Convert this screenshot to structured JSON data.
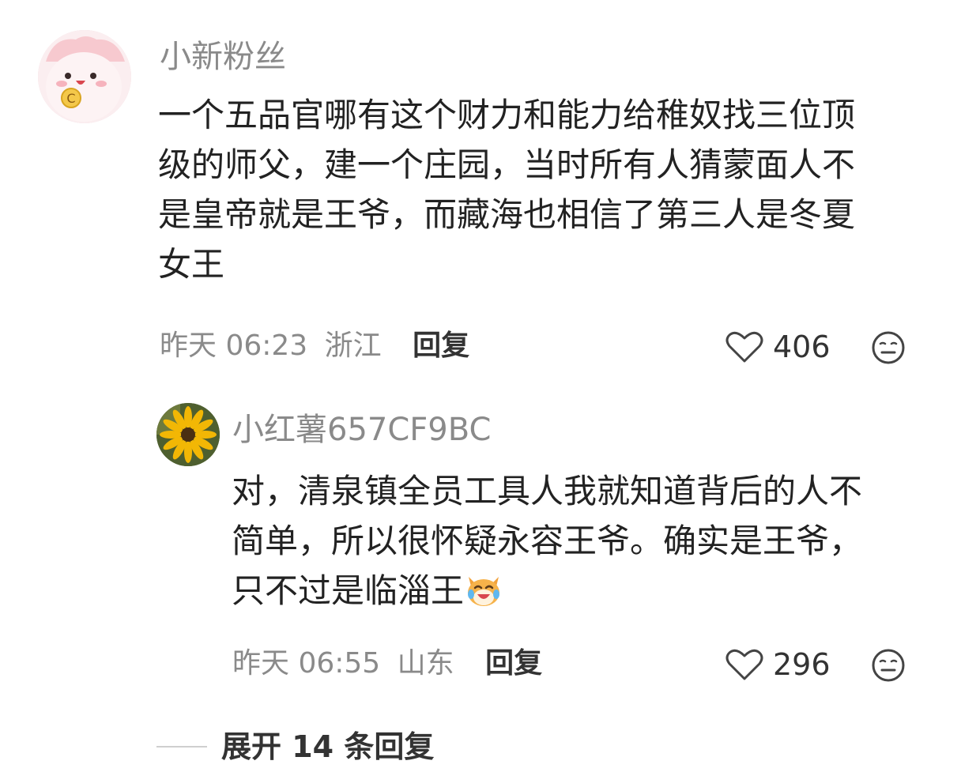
{
  "comment": {
    "username": "小新粉丝",
    "lines": [
      "一个五品官哪有这个财力和能力给稚奴找三位顶",
      "级的师父，建一个庄园，当时所有人猜蒙面人不",
      "是皇帝就是王爷，而藏海也相信了第三人是冬夏",
      "女王"
    ],
    "time": "昨天 06:23",
    "location": "浙江",
    "reply_label": "回复",
    "likes": "406",
    "avatar_icon": "cartoon-avatar-icon"
  },
  "reply": {
    "username": "小红薯657CF9BC",
    "lines": [
      "对，清泉镇全员工具人我就知道背后的人不",
      "简单，所以很怀疑永容王爷。确实是王爷，",
      "只不过是临淄王"
    ],
    "emoji": "laughing-cat-emoji",
    "time": "昨天 06:55",
    "location": "山东",
    "reply_label": "回复",
    "likes": "296",
    "avatar_icon": "sunflower-avatar-icon"
  },
  "expand": {
    "label": "展开 14 条回复"
  },
  "icons": {
    "like": "heart-outline-icon",
    "reaction": "neutral-face-icon"
  }
}
